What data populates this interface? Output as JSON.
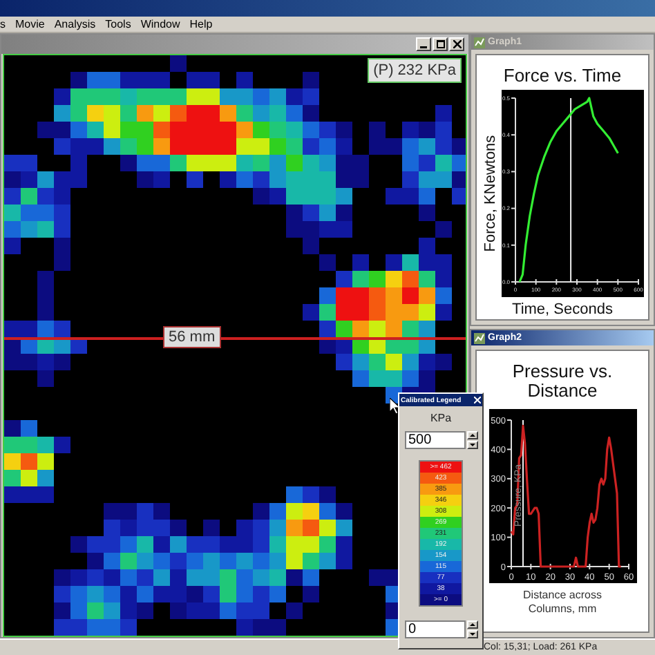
{
  "menu": [
    {
      "label": "s"
    },
    {
      "label": "Movie"
    },
    {
      "label": "Analysis"
    },
    {
      "label": "Tools"
    },
    {
      "label": "Window"
    },
    {
      "label": "Help"
    }
  ],
  "map_window": {
    "active": false,
    "readout": "(P) 232 KPa",
    "ruler_label": "56 mm"
  },
  "graph1": {
    "title": "Graph1",
    "active": false,
    "chart_data": {
      "type": "line",
      "title": "Force vs. Time",
      "xlabel": "Time, Seconds",
      "ylabel": "Force, KNewtons",
      "xlim": [
        0,
        600
      ],
      "ylim": [
        0,
        0.5
      ],
      "xticks": [
        0,
        100,
        200,
        300,
        400,
        500,
        600
      ],
      "yticks": [
        {
          "value": 0,
          "label": "0.0"
        },
        {
          "value": 0.1,
          "label": "0.1"
        },
        {
          "value": 0.2,
          "label": "0.2"
        },
        {
          "value": 0.3,
          "label": "0.3"
        },
        {
          "value": 0.4,
          "label": "0.4"
        },
        {
          "value": 0.5,
          "label": "0.5"
        }
      ],
      "x": [
        20,
        35,
        50,
        70,
        90,
        110,
        140,
        170,
        200,
        230,
        260,
        290,
        320,
        350,
        360,
        380,
        400,
        430,
        460,
        480,
        500
      ],
      "series": [
        {
          "color": "#33ee33",
          "values": [
            0,
            0.02,
            0.1,
            0.18,
            0.24,
            0.29,
            0.34,
            0.38,
            0.41,
            0.43,
            0.45,
            0.47,
            0.48,
            0.49,
            0.5,
            0.45,
            0.43,
            0.41,
            0.39,
            0.37,
            0.35
          ]
        }
      ],
      "ref_lines": [
        {
          "axis": "x",
          "value": 270
        }
      ]
    }
  },
  "graph2": {
    "title": "Graph2",
    "active": true,
    "chart_data": {
      "type": "line",
      "title": "Pressure vs. Distance",
      "xlabel": "Distance across Columns, mm",
      "ylabel": "Pressure, KPa",
      "xlim": [
        0,
        60
      ],
      "ylim": [
        0,
        500
      ],
      "xticks": [
        0,
        10,
        20,
        30,
        40,
        50,
        60
      ],
      "yticks": [
        0,
        100,
        200,
        300,
        400,
        500
      ],
      "x": [
        0,
        1,
        2,
        3,
        4,
        5,
        6,
        7,
        8,
        9,
        10,
        11,
        12,
        13,
        14,
        15,
        16,
        32,
        33,
        34,
        35,
        38,
        39,
        40,
        41,
        42,
        43,
        44,
        45,
        46,
        47,
        48,
        49,
        50,
        51,
        52,
        53,
        54,
        55,
        56
      ],
      "series": [
        {
          "color": "#cc2222",
          "values": [
            120,
            110,
            200,
            210,
            370,
            380,
            480,
            420,
            300,
            180,
            180,
            190,
            200,
            200,
            180,
            0,
            0,
            0,
            30,
            0,
            0,
            0,
            100,
            150,
            180,
            150,
            160,
            200,
            280,
            300,
            280,
            300,
            400,
            440,
            400,
            350,
            300,
            250,
            0,
            0
          ]
        }
      ],
      "ref_lines": [
        {
          "axis": "x",
          "value": 6
        }
      ]
    }
  },
  "legend": {
    "title": "Calibrated Legend",
    "unit": "KPa",
    "max": "500",
    "min": "0",
    "levels": [
      {
        "label": ">= 462",
        "color": "#ee1111"
      },
      {
        "label": "423",
        "color": "#f55a10"
      },
      {
        "label": "385",
        "color": "#f89a10"
      },
      {
        "label": "346",
        "color": "#f5d010"
      },
      {
        "label": "308",
        "color": "#ccee10"
      },
      {
        "label": "269",
        "color": "#30d020"
      },
      {
        "label": "231",
        "color": "#20c878"
      },
      {
        "label": "192",
        "color": "#18b8a8"
      },
      {
        "label": "154",
        "color": "#1898c8"
      },
      {
        "label": "115",
        "color": "#1868d8"
      },
      {
        "label": "77",
        "color": "#1830c0"
      },
      {
        "label": "38",
        "color": "#1018a0"
      },
      {
        "label": ">= 0",
        "color": "#0c0c80"
      }
    ]
  },
  "status_bar": "Col: 15,31;  Load: 261 KPa"
}
